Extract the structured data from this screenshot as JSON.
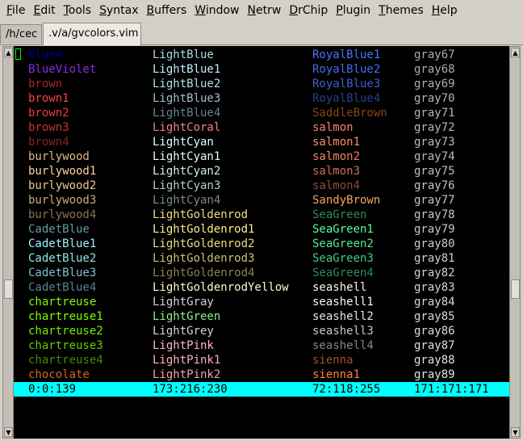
{
  "menu": [
    {
      "acc": "F",
      "rest": "ile"
    },
    {
      "acc": "E",
      "rest": "dit"
    },
    {
      "acc": "T",
      "rest": "ools"
    },
    {
      "acc": "S",
      "rest": "yntax"
    },
    {
      "acc": "B",
      "rest": "uffers"
    },
    {
      "acc": "W",
      "rest": "indow"
    },
    {
      "acc": "N",
      "rest": "etrw"
    },
    {
      "acc": "D",
      "rest": "rChip"
    },
    {
      "acc": "P",
      "rest": "lugin"
    },
    {
      "acc": "T",
      "rest": "hemes"
    },
    {
      "acc": "H",
      "rest": "elp"
    }
  ],
  "tabs": [
    {
      "label": "/h/cec",
      "active": false
    },
    {
      "label": ".v/a/gvcolors.vim",
      "active": true
    }
  ],
  "rows": [
    [
      {
        "text": "Blue4",
        "color": "#00008b"
      },
      {
        "text": "LightBlue",
        "color": "#add8e6"
      },
      {
        "text": "RoyalBlue1",
        "color": "#4876ff"
      },
      {
        "text": "gray67",
        "color": "#ababab"
      }
    ],
    [
      {
        "text": "BlueViolet",
        "color": "#8a2be2"
      },
      {
        "text": "LightBlue1",
        "color": "#bfefff"
      },
      {
        "text": "RoyalBlue2",
        "color": "#436eee"
      },
      {
        "text": "gray68",
        "color": "#adadad"
      }
    ],
    [
      {
        "text": "brown",
        "color": "#a52a2a"
      },
      {
        "text": "LightBlue2",
        "color": "#b2dfee"
      },
      {
        "text": "RoyalBlue3",
        "color": "#3a5fcd"
      },
      {
        "text": "gray69",
        "color": "#b0b0b0"
      }
    ],
    [
      {
        "text": "brown1",
        "color": "#ff4040"
      },
      {
        "text": "LightBlue3",
        "color": "#9ac0cd"
      },
      {
        "text": "RoyalBlue4",
        "color": "#27408b"
      },
      {
        "text": "gray70",
        "color": "#b3b3b3"
      }
    ],
    [
      {
        "text": "brown2",
        "color": "#ee3b3b"
      },
      {
        "text": "LightBlue4",
        "color": "#68838b"
      },
      {
        "text": "SaddleBrown",
        "color": "#8b4513"
      },
      {
        "text": "gray71",
        "color": "#b5b5b5"
      }
    ],
    [
      {
        "text": "brown3",
        "color": "#cd3333"
      },
      {
        "text": "LightCoral",
        "color": "#f08080"
      },
      {
        "text": "salmon",
        "color": "#fa8072"
      },
      {
        "text": "gray72",
        "color": "#b8b8b8"
      }
    ],
    [
      {
        "text": "brown4",
        "color": "#8b2323"
      },
      {
        "text": "LightCyan",
        "color": "#e0ffff"
      },
      {
        "text": "salmon1",
        "color": "#ff8c69"
      },
      {
        "text": "gray73",
        "color": "#bababa"
      }
    ],
    [
      {
        "text": "burlywood",
        "color": "#deb887"
      },
      {
        "text": "LightCyan1",
        "color": "#e0ffff"
      },
      {
        "text": "salmon2",
        "color": "#ee8262"
      },
      {
        "text": "gray74",
        "color": "#bdbdbd"
      }
    ],
    [
      {
        "text": "burlywood1",
        "color": "#ffd39b"
      },
      {
        "text": "LightCyan2",
        "color": "#d1eeee"
      },
      {
        "text": "salmon3",
        "color": "#cd7054"
      },
      {
        "text": "gray75",
        "color": "#bfbfbf"
      }
    ],
    [
      {
        "text": "burlywood2",
        "color": "#eec591"
      },
      {
        "text": "LightCyan3",
        "color": "#b4cdcd"
      },
      {
        "text": "salmon4",
        "color": "#8b4c39"
      },
      {
        "text": "gray76",
        "color": "#c2c2c2"
      }
    ],
    [
      {
        "text": "burlywood3",
        "color": "#cdaa7d"
      },
      {
        "text": "LightCyan4",
        "color": "#7a8b8b"
      },
      {
        "text": "SandyBrown",
        "color": "#f4a460"
      },
      {
        "text": "gray77",
        "color": "#c4c4c4"
      }
    ],
    [
      {
        "text": "burlywood4",
        "color": "#8b7355"
      },
      {
        "text": "LightGoldenrod",
        "color": "#eedd82"
      },
      {
        "text": "SeaGreen",
        "color": "#2e8b57"
      },
      {
        "text": "gray78",
        "color": "#c7c7c7"
      }
    ],
    [
      {
        "text": "CadetBlue",
        "color": "#5f9ea0"
      },
      {
        "text": "LightGoldenrod1",
        "color": "#ffec8b"
      },
      {
        "text": "SeaGreen1",
        "color": "#54ff9f"
      },
      {
        "text": "gray79",
        "color": "#c9c9c9"
      }
    ],
    [
      {
        "text": "CadetBlue1",
        "color": "#98f5ff"
      },
      {
        "text": "LightGoldenrod2",
        "color": "#eedc82"
      },
      {
        "text": "SeaGreen2",
        "color": "#4eee94"
      },
      {
        "text": "gray80",
        "color": "#cccccc"
      }
    ],
    [
      {
        "text": "CadetBlue2",
        "color": "#8ee5ee"
      },
      {
        "text": "LightGoldenrod3",
        "color": "#cdbe70"
      },
      {
        "text": "SeaGreen3",
        "color": "#43cd80"
      },
      {
        "text": "gray81",
        "color": "#cfcfcf"
      }
    ],
    [
      {
        "text": "CadetBlue3",
        "color": "#7ac5cd"
      },
      {
        "text": "LightGoldenrod4",
        "color": "#8b814c"
      },
      {
        "text": "SeaGreen4",
        "color": "#2e8b57"
      },
      {
        "text": "gray82",
        "color": "#d1d1d1"
      }
    ],
    [
      {
        "text": "CadetBlue4",
        "color": "#53868b"
      },
      {
        "text": "LightGoldenrodYellow",
        "color": "#fafad2"
      },
      {
        "text": "seashell",
        "color": "#fff5ee"
      },
      {
        "text": "gray83",
        "color": "#d4d4d4"
      }
    ],
    [
      {
        "text": "chartreuse",
        "color": "#7fff00"
      },
      {
        "text": "LightGray",
        "color": "#d3d3d3"
      },
      {
        "text": "seashell1",
        "color": "#fff5ee"
      },
      {
        "text": "gray84",
        "color": "#d6d6d6"
      }
    ],
    [
      {
        "text": "chartreuse1",
        "color": "#7fff00"
      },
      {
        "text": "LightGreen",
        "color": "#90ee90"
      },
      {
        "text": "seashell2",
        "color": "#eee5de"
      },
      {
        "text": "gray85",
        "color": "#d9d9d9"
      }
    ],
    [
      {
        "text": "chartreuse2",
        "color": "#76ee00"
      },
      {
        "text": "LightGrey",
        "color": "#d3d3d3"
      },
      {
        "text": "seashell3",
        "color": "#cdc5bf"
      },
      {
        "text": "gray86",
        "color": "#dbdbdb"
      }
    ],
    [
      {
        "text": "chartreuse3",
        "color": "#66cd00"
      },
      {
        "text": "LightPink",
        "color": "#ffb6c1"
      },
      {
        "text": "seashell4",
        "color": "#8b8682"
      },
      {
        "text": "gray87",
        "color": "#dedede"
      }
    ],
    [
      {
        "text": "chartreuse4",
        "color": "#458b00"
      },
      {
        "text": "LightPink1",
        "color": "#ffaeb9"
      },
      {
        "text": "sienna",
        "color": "#a0522d"
      },
      {
        "text": "gray88",
        "color": "#e0e0e0"
      }
    ],
    [
      {
        "text": "chocolate",
        "color": "#d2691e"
      },
      {
        "text": "LightPink2",
        "color": "#eea2ad"
      },
      {
        "text": "sienna1",
        "color": "#ff8247"
      },
      {
        "text": "gray89",
        "color": "#e3e3e3"
      }
    ]
  ],
  "status": [
    "0:0:139",
    "173:216:230",
    "72:118:255",
    "171:171:171"
  ],
  "colors": {
    "status_bg": "#00ffff",
    "cursor": "#00ff00",
    "editor_bg": "#000000",
    "chrome_bg": "#d4d0c8"
  }
}
